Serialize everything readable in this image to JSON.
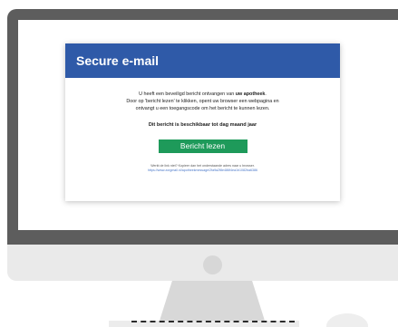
{
  "email": {
    "header_title": "Secure e-mail",
    "intro_line1_prefix": "U heeft een beveiligd bericht ontvangen van ",
    "intro_sender": "uw apotheek",
    "intro_line1_suffix": ".",
    "intro_line2": "Door op 'bericht lezen' te klikken, opent uw browser een webpagina en",
    "intro_line3": "ontvangt u een toegangscode om het bericht te kunnen lezen.",
    "availability": "Dit bericht is beschikbaar tot dag maand jaar",
    "read_button_label": "Bericht lezen",
    "fallback_text": "Werkt de link niet? Kopieer dan het onderstaande adres naar u browser.",
    "fallback_link": "https://www.zorgmail.nl/apotheekmessage/2fa9a2f8e486f4ea1b1082ba6386"
  },
  "colors": {
    "header_blue": "#2f5aa8",
    "button_green": "#1e9a5a",
    "monitor_bezel": "#5d5d5d"
  }
}
